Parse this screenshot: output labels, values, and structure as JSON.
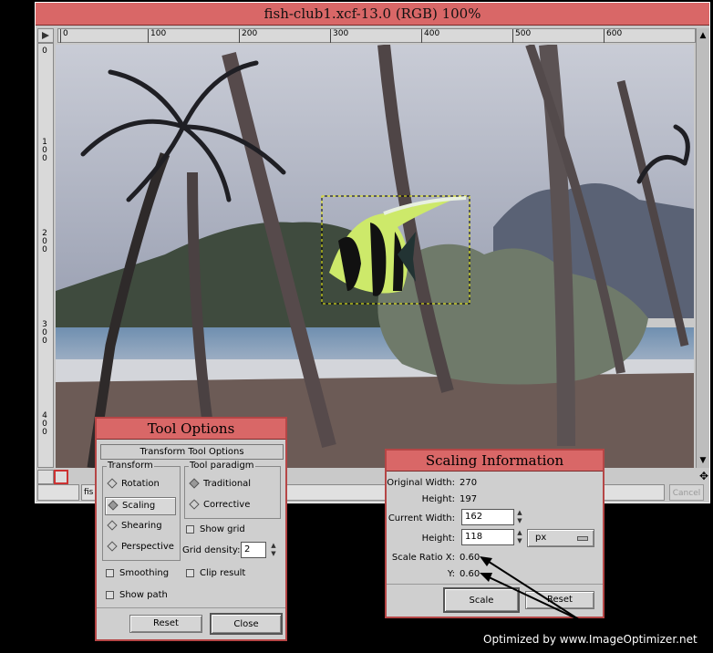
{
  "window": {
    "title": "fish-club1.xcf-13.0 (RGB) 100%",
    "cancel_label": "Cancel",
    "status_text": "fis"
  },
  "ruler": {
    "h_ticks": [
      "0",
      "100",
      "200",
      "300",
      "400",
      "500",
      "600"
    ],
    "v_ticks": [
      [
        "0"
      ],
      [
        "1",
        "0",
        "0"
      ],
      [
        "2",
        "0",
        "0"
      ],
      [
        "3",
        "0",
        "0"
      ],
      [
        "4",
        "0",
        "0"
      ]
    ]
  },
  "tool_options": {
    "title": "Tool Options",
    "header": "Transform Tool Options",
    "transform_group": "Transform",
    "transform_items": [
      "Rotation",
      "Scaling",
      "Shearing",
      "Perspective"
    ],
    "selected_transform": "Scaling",
    "paradigm_group": "Tool paradigm",
    "paradigm_items": [
      "Traditional",
      "Corrective"
    ],
    "show_grid": "Show grid",
    "grid_density_label": "Grid density:",
    "grid_density_value": "2",
    "smoothing": "Smoothing",
    "clip_result": "Clip result",
    "show_path": "Show path",
    "reset": "Reset",
    "close": "Close"
  },
  "scaling": {
    "title": "Scaling Information",
    "original_width_label": "Original Width:",
    "original_width": "270",
    "original_height_label": "Height:",
    "original_height": "197",
    "current_width_label": "Current Width:",
    "current_width": "162",
    "height_label": "Height:",
    "current_height": "118",
    "unit": "px",
    "ratio_x_label": "Scale Ratio X:",
    "ratio_x": "0.60",
    "ratio_y_label": "Y:",
    "ratio_y": "0.60",
    "scale_btn": "Scale",
    "reset_btn": "Reset"
  },
  "watermark": "Optimized by www.ImageOptimizer.net",
  "colors": {
    "title_bar": "#d96767",
    "dialog_bg": "#cfcfcf",
    "accent": "#b54646"
  }
}
